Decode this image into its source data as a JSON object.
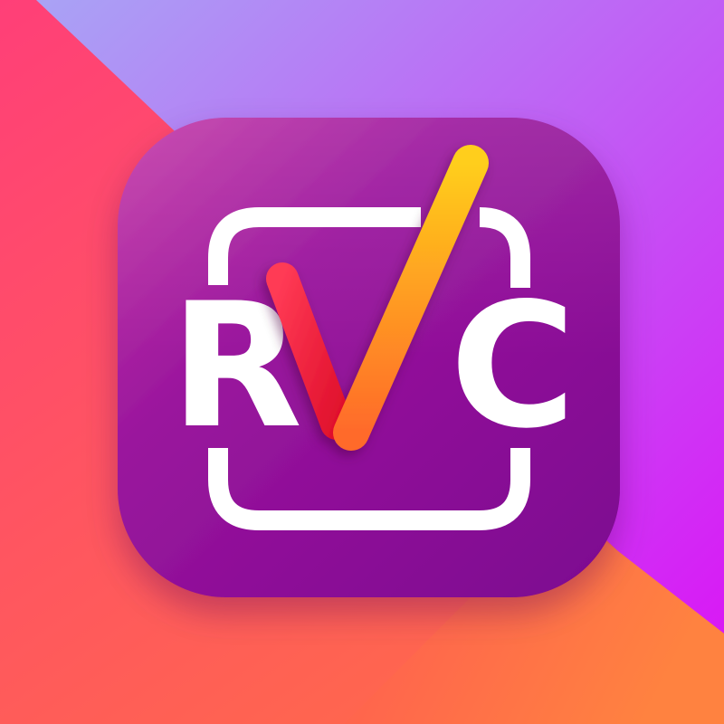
{
  "icon": {
    "letters": [
      "R",
      "C"
    ],
    "colors": {
      "background_top": "#a9a3f5",
      "background_right": "#d917f5",
      "background_left": "#ff3f78",
      "background_bottom": "#ff8240",
      "tile_light": "#c53ba8",
      "tile_dark": "#7c0590",
      "frame_and_letters": "#ffffff",
      "check_short_stroke": "#ff2a4a",
      "check_long_stroke_top": "#ffce1a",
      "check_long_stroke_bottom": "#ff6a2a"
    },
    "elements": {
      "frame": "rounded-square-frame",
      "check": "check-mark-icon"
    }
  }
}
